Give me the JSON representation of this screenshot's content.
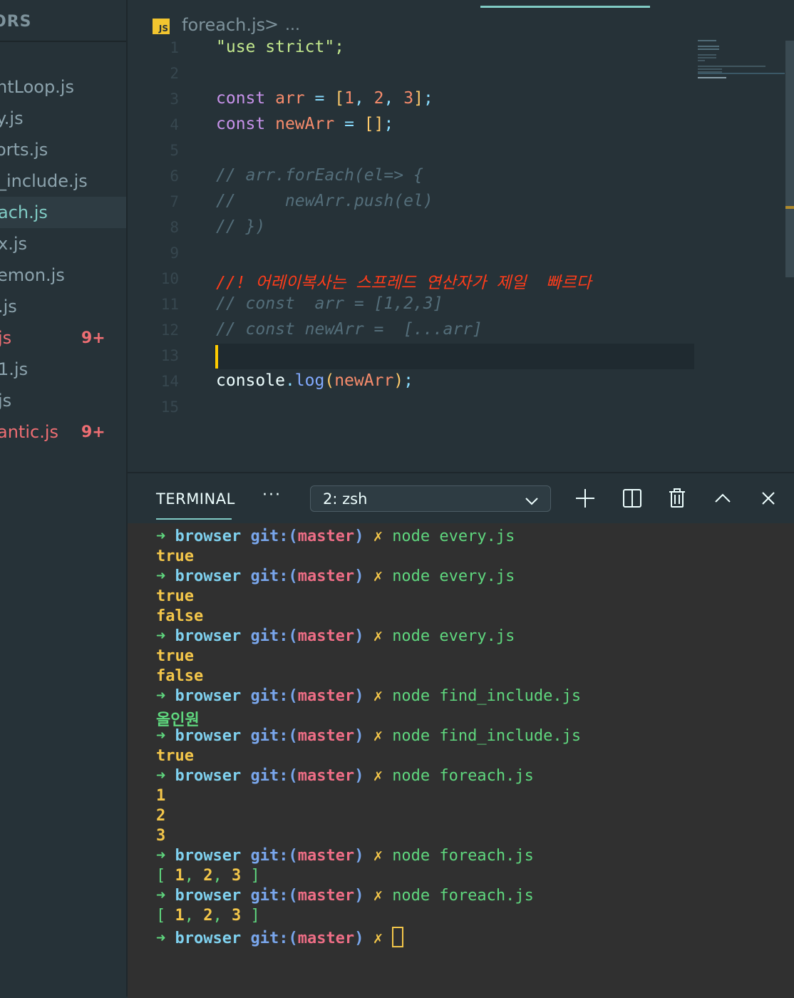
{
  "sidebar": {
    "title": "ORS",
    "files": [
      {
        "name": "ntLoop.js"
      },
      {
        "name": "y.js"
      },
      {
        "name": "orts.js"
      },
      {
        "name": "_include.js"
      },
      {
        "name": "ach.js",
        "active": true
      },
      {
        "name": "x.js"
      },
      {
        "name": "emon.js"
      },
      {
        "name": ".js"
      },
      {
        "name": "js",
        "badge": "9+"
      },
      {
        "name": "1.js"
      },
      {
        "name": "js"
      },
      {
        "name": "antic.js",
        "badge": "9+"
      }
    ]
  },
  "editor": {
    "breadcrumb": {
      "icon_text": "JS",
      "file": "foreach.js",
      "separator": ">",
      "more": "..."
    },
    "line_numbers": [
      "1",
      "2",
      "3",
      "4",
      "5",
      "6",
      "7",
      "8",
      "9",
      "10",
      "11",
      "12",
      "13",
      "14",
      "15"
    ],
    "code": {
      "l1": "\"use strict\";",
      "l3": {
        "kw": "const",
        "name": "arr",
        "eq": "=",
        "open": "[",
        "n1": "1",
        "n2": "2",
        "n3": "3",
        "close": "]",
        "end": ";",
        "comma": ","
      },
      "l4": {
        "kw": "const",
        "name": "newArr",
        "eq": "=",
        "arr": "[]",
        "end": ";"
      },
      "l6": "// arr.forEach(el=> {",
      "l7": "//     newArr.push(el)",
      "l8": "// })",
      "l10": "//! 어레이복사는 스프레드 연산자가 제일  빠르다",
      "l11": "// const  arr = [1,2,3]",
      "l12": "// const newArr =  [...arr]",
      "l14": {
        "obj": "console",
        "dot": ".",
        "fn": "log",
        "open": "(",
        "arg": "newArr",
        "close": ")",
        "end": ";"
      }
    }
  },
  "terminal": {
    "tab_label": "TERMINAL",
    "more_label": "···",
    "selected_terminal": "2: zsh",
    "prompt": {
      "arrow": "➜",
      "dir": "browser",
      "git": "git:",
      "open": "(",
      "branch": "master",
      "close": ")",
      "x": "✗"
    },
    "lines": [
      {
        "type": "prompt",
        "cmd": "node every.js"
      },
      {
        "type": "out",
        "text": "true"
      },
      {
        "type": "prompt",
        "cmd": "node every.js"
      },
      {
        "type": "out",
        "text": "true"
      },
      {
        "type": "out",
        "text": "false"
      },
      {
        "type": "prompt",
        "cmd": "node every.js"
      },
      {
        "type": "out",
        "text": "true"
      },
      {
        "type": "out",
        "text": "false"
      },
      {
        "type": "prompt",
        "cmd": "node find_include.js"
      },
      {
        "type": "out-green",
        "text": "올인원"
      },
      {
        "type": "prompt",
        "cmd": "node find_include.js"
      },
      {
        "type": "out",
        "text": "true"
      },
      {
        "type": "prompt",
        "cmd": "node foreach.js"
      },
      {
        "type": "out",
        "text": "1"
      },
      {
        "type": "out",
        "text": "2"
      },
      {
        "type": "out",
        "text": "3"
      },
      {
        "type": "prompt",
        "cmd": "node foreach.js"
      },
      {
        "type": "array",
        "items": [
          "1",
          "2",
          "3"
        ]
      },
      {
        "type": "prompt",
        "cmd": "node foreach.js"
      },
      {
        "type": "array",
        "items": [
          "1",
          "2",
          "3"
        ]
      },
      {
        "type": "prompt-cursor"
      }
    ]
  },
  "colors": {
    "background": "#263238",
    "terminal_background": "#303030",
    "accent": "#80cbc4",
    "badge": "#ee6e73",
    "caret": "#ffcc00"
  }
}
